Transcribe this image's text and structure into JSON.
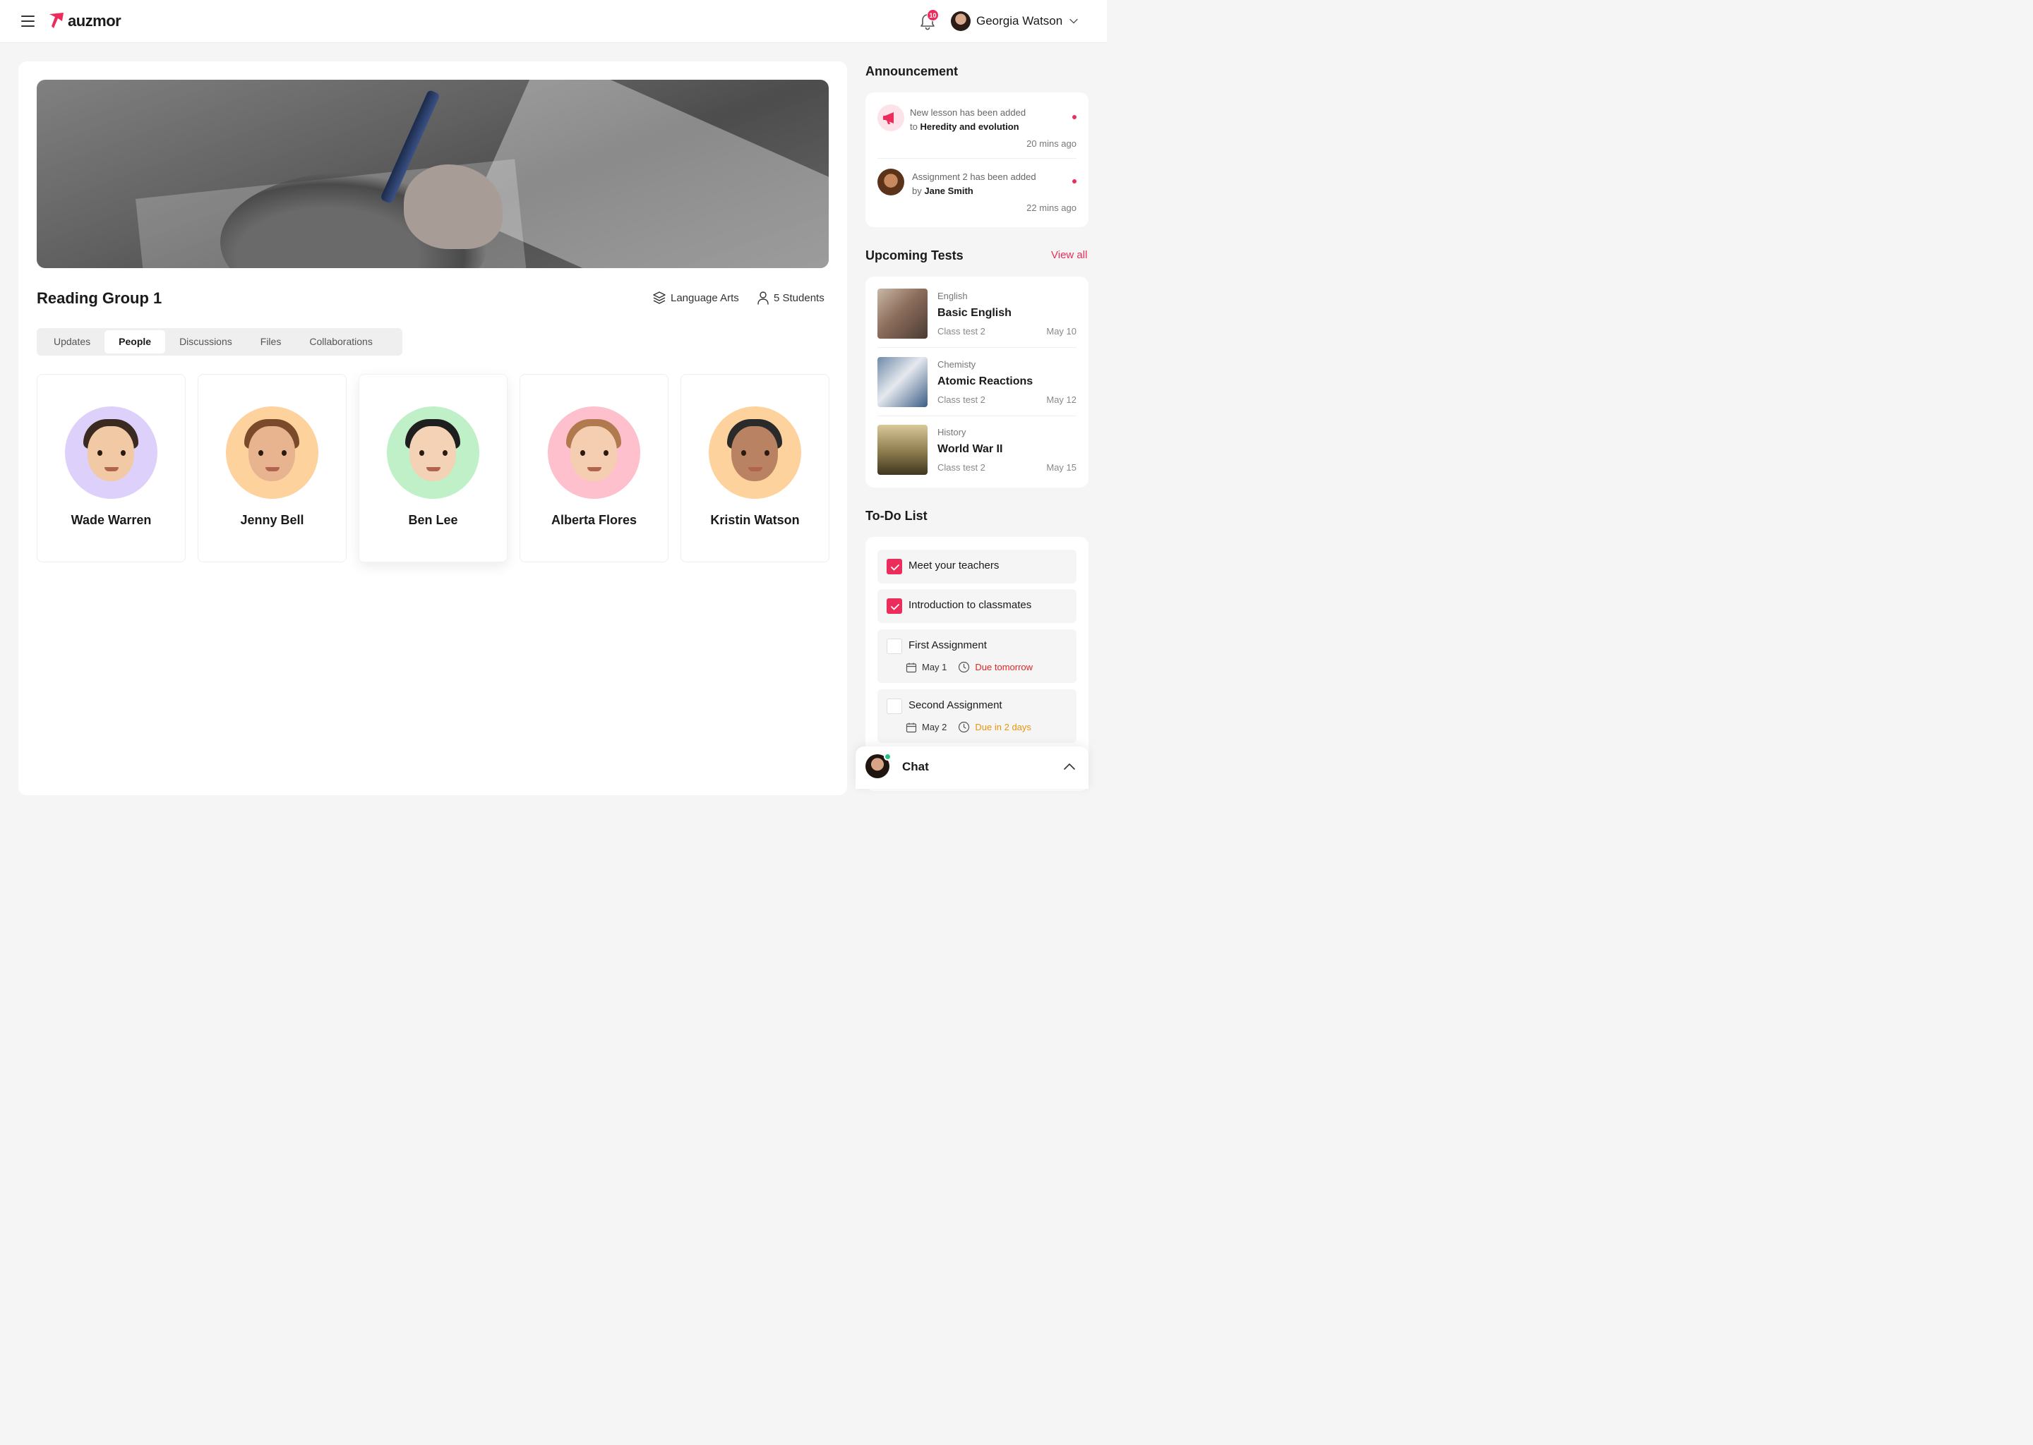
{
  "app": {
    "brand": "auzmor",
    "brand_color": "#ec2d5c",
    "notifications_count": "10",
    "user_name": "Georgia Watson"
  },
  "group": {
    "title": "Reading Group 1",
    "subject": "Language Arts",
    "students": "5 Students"
  },
  "tabs": [
    {
      "label": "Updates"
    },
    {
      "label": "People",
      "active": true
    },
    {
      "label": "Discussions"
    },
    {
      "label": "Files"
    },
    {
      "label": "Collaborations"
    }
  ],
  "people": [
    {
      "name": "Wade Warren",
      "bg": "#ddd0fb"
    },
    {
      "name": "Jenny Bell",
      "bg": "#fed29d"
    },
    {
      "name": "Ben Lee",
      "bg": "#bff0c8"
    },
    {
      "name": "Alberta Flores",
      "bg": "#fdc0cc"
    },
    {
      "name": "Kristin Watson",
      "bg": "#fed29d"
    }
  ],
  "announcement": {
    "title": "Announcement",
    "items": [
      {
        "prefix": "New lesson has been added",
        "connector": "to",
        "bold": "Heredity and evolution",
        "time": "20 mins ago"
      },
      {
        "prefix": "Assignment 2 has been added",
        "connector": "by",
        "bold": "Jane Smith",
        "time": "22 mins ago"
      }
    ]
  },
  "tests": {
    "title": "Upcoming Tests",
    "view_all": "View all",
    "items": [
      {
        "subject": "English",
        "name": "Basic English",
        "type": "Class test 2",
        "date": "May 10"
      },
      {
        "subject": "Chemisty",
        "name": "Atomic Reactions",
        "type": "Class test 2",
        "date": "May 12"
      },
      {
        "subject": "History",
        "name": "World War II",
        "type": "Class test 2",
        "date": "May 15"
      }
    ]
  },
  "todo": {
    "title": "To-Do List",
    "items": [
      {
        "label": "Meet your teachers",
        "checked": true
      },
      {
        "label": "Introduction to classmates",
        "checked": true
      },
      {
        "label": "First Assignment",
        "checked": false,
        "date": "May 1",
        "due": "Due tomorrow",
        "due_color": "#e02424"
      },
      {
        "label": "Second Assignment",
        "checked": false,
        "date": "May 2",
        "due": "Due in 2 days",
        "due_color": "#e8950c"
      }
    ]
  },
  "chat": {
    "label": "Chat"
  }
}
